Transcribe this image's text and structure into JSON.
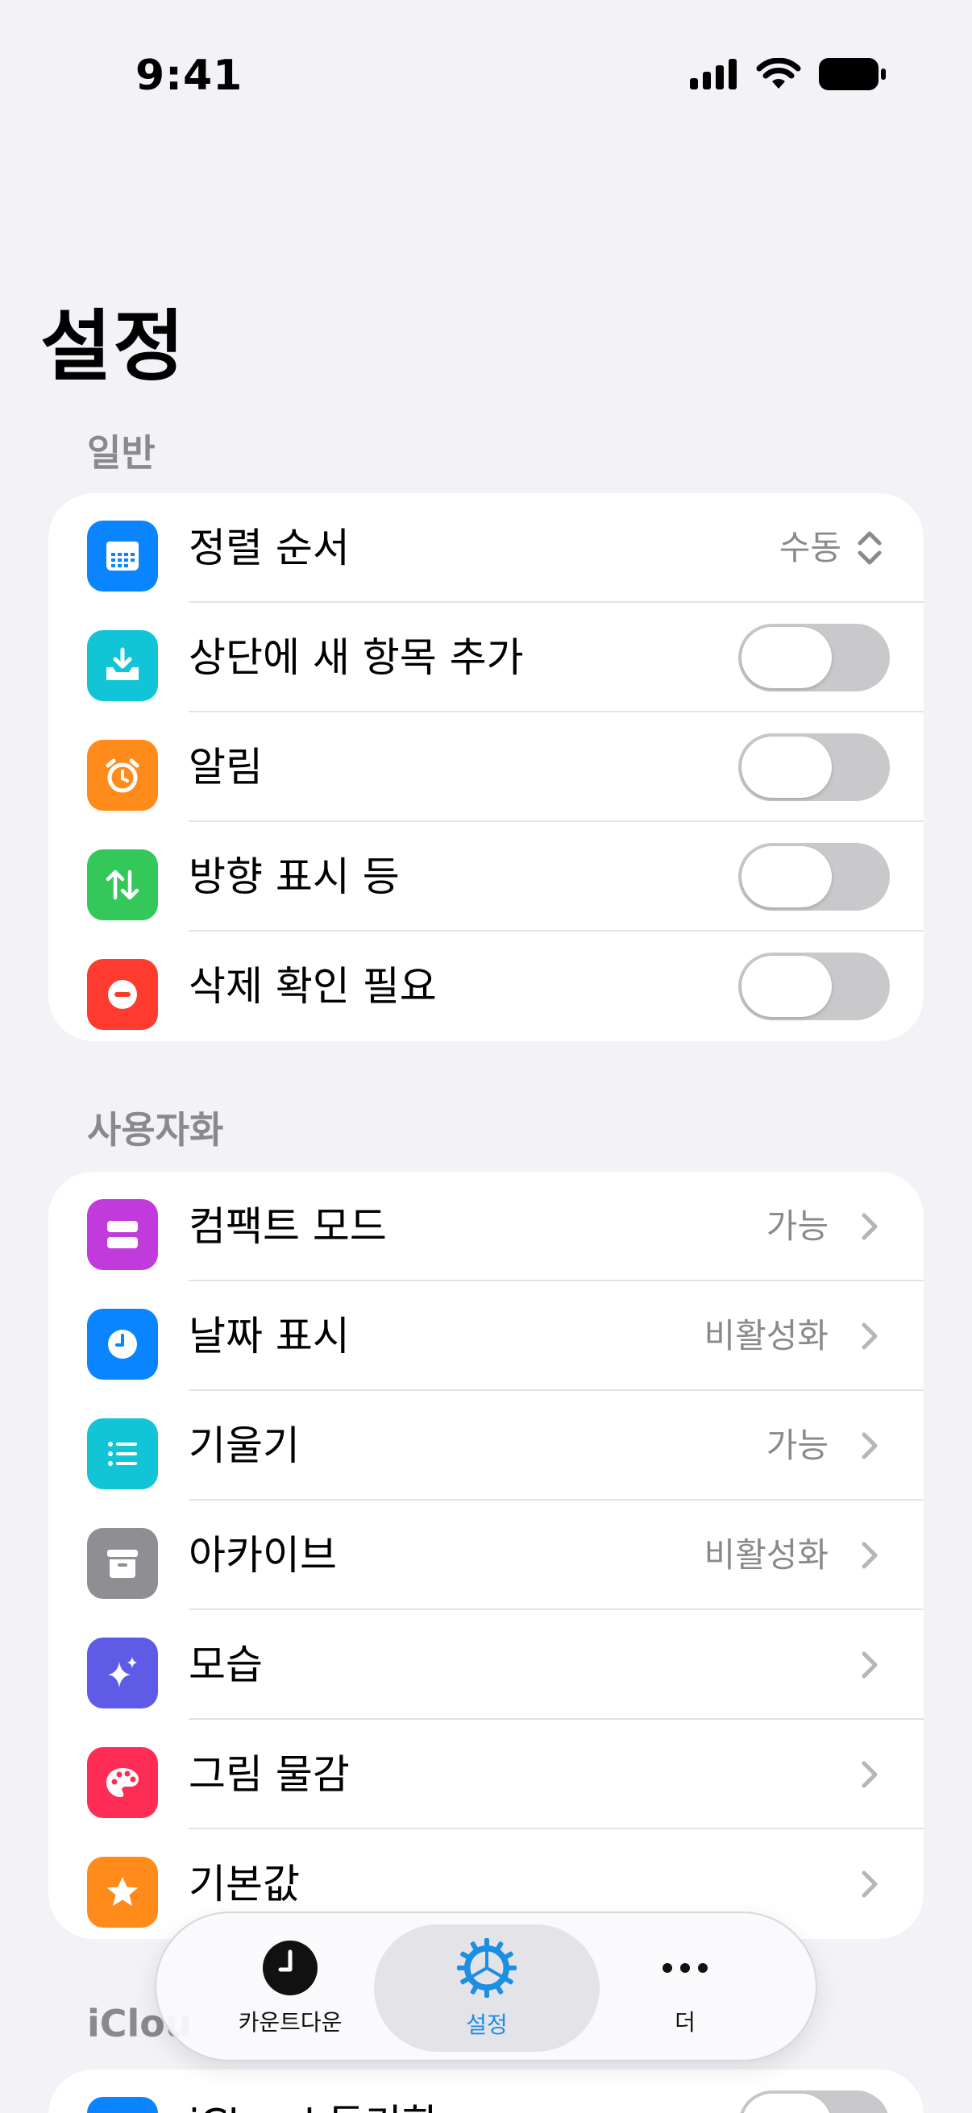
{
  "status_bar": {
    "time": "9:41"
  },
  "page": {
    "title": "설정"
  },
  "sections": {
    "general": {
      "header": "일반",
      "rows": [
        {
          "label": "정렬 순서",
          "value": "수동",
          "icon": "calendar-grid-icon",
          "color": "#0a84ff"
        },
        {
          "label": "상단에 새 항목 추가",
          "toggle": false,
          "icon": "tray-download-icon",
          "color": "#12c5d6"
        },
        {
          "label": "알림",
          "toggle": false,
          "icon": "alarm-clock-icon",
          "color": "#ff8c1a"
        },
        {
          "label": "방향 표시 등",
          "toggle": false,
          "icon": "up-down-arrows-icon",
          "color": "#34c759"
        },
        {
          "label": "삭제 확인 필요",
          "toggle": false,
          "icon": "minus-circle-icon",
          "color": "#ff3b30"
        }
      ]
    },
    "customize": {
      "header": "사용자화",
      "rows": [
        {
          "label": "컴팩트 모드",
          "value": "가능",
          "icon": "two-bars-icon",
          "color": "#c13bdc"
        },
        {
          "label": "날짜 표시",
          "value": "비활성화",
          "icon": "clock-icon",
          "color": "#0a84ff"
        },
        {
          "label": "기울기",
          "value": "가능",
          "icon": "list-icon",
          "color": "#12c5d6"
        },
        {
          "label": "아카이브",
          "value": "비활성화",
          "icon": "archive-box-icon",
          "color": "#8e8e93"
        },
        {
          "label": "모습",
          "value": "",
          "icon": "sparkles-icon",
          "color": "#5e5ce6"
        },
        {
          "label": "그림 물감",
          "value": "",
          "icon": "palette-icon",
          "color": "#ff2d55"
        },
        {
          "label": "기본값",
          "value": "",
          "icon": "star-icon",
          "color": "#ff8c1a"
        }
      ]
    },
    "icloud": {
      "header_partial": "iClou",
      "rows": [
        {
          "label": "iCloud 동기화",
          "toggle": false,
          "color": "#0a84ff"
        }
      ]
    }
  },
  "tabbar": {
    "tabs": [
      {
        "label": "카운트다운",
        "icon": "clock-tab-icon",
        "active": false
      },
      {
        "label": "설정",
        "icon": "gear-icon",
        "active": true
      },
      {
        "label": "더",
        "icon": "ellipsis-icon",
        "active": false
      }
    ],
    "active_color": "#1c8fe3"
  }
}
